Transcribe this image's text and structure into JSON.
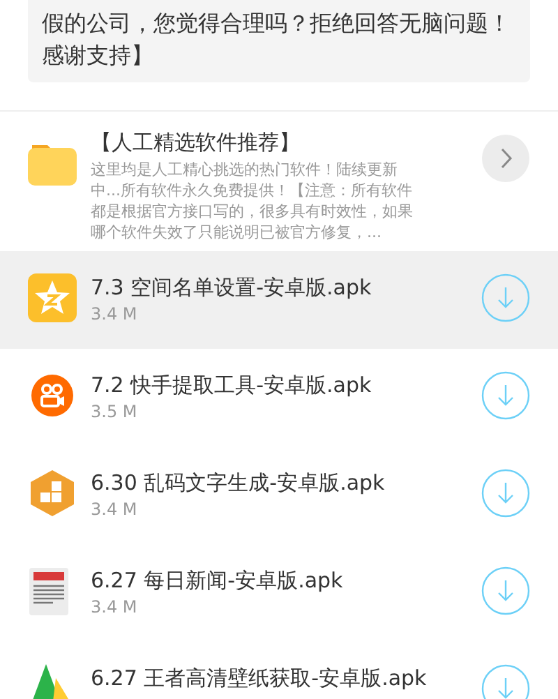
{
  "notice": {
    "lines": [
      "假的公司，您觉得合理吗？拒绝回答无脑问题！",
      "感谢支持】"
    ]
  },
  "folder": {
    "title": "【人工精选软件推荐】",
    "description": "这里均是人工精心挑选的热门软件！陆续更新中...所有软件永久免费提供！【注意：所有软件都是根据官方接口写的，很多具有时效性，如果哪个软件失效了只能说明已被官方修复，..."
  },
  "files": [
    {
      "name": "7.3 空间名单设置-安卓版.apk",
      "size": "3.4 M",
      "kind": "star",
      "highlighted": true
    },
    {
      "name": "7.2 快手提取工具-安卓版.apk",
      "size": "3.5 M",
      "kind": "camera",
      "highlighted": false
    },
    {
      "name": "6.30 乱码文字生成-安卓版.apk",
      "size": "3.4 M",
      "kind": "blocks",
      "highlighted": false
    },
    {
      "name": "6.27 每日新闻-安卓版.apk",
      "size": "3.4 M",
      "kind": "news",
      "highlighted": false
    },
    {
      "name": "6.27 王者高清壁纸获取-安卓版.apk",
      "kind": "triangle",
      "highlighted": false
    }
  ]
}
